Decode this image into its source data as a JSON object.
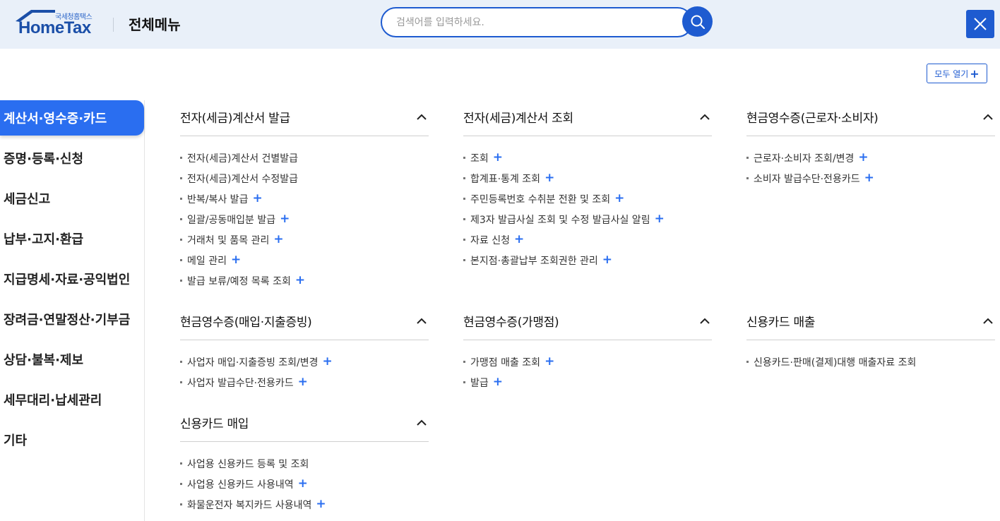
{
  "header": {
    "logo_sub": "국세청홈택스",
    "logo_main": "HomeTax",
    "title": "전체메뉴",
    "search_placeholder": "검색어를 입력하세요.",
    "search_icon": "search-icon",
    "close_icon": "close-icon"
  },
  "open_all": {
    "label": "모두 열기",
    "plus": "+"
  },
  "sidebar": {
    "items": [
      {
        "label": "계산서·영수증·카드",
        "active": true
      },
      {
        "label": "증명·등록·신청"
      },
      {
        "label": "세금신고"
      },
      {
        "label": "납부·고지·환급"
      },
      {
        "label": "지급명세·자료·공익법인"
      },
      {
        "label": "장려금·연말정산·기부금"
      },
      {
        "label": "상담·불복·제보"
      },
      {
        "label": "세무대리·납세관리"
      },
      {
        "label": "기타"
      }
    ]
  },
  "sections": [
    {
      "title": "전자(세금)계산서 발급",
      "items": [
        {
          "label": "전자(세금)계산서 건별발급",
          "plus": false
        },
        {
          "label": "전자(세금)계산서 수정발급",
          "plus": false
        },
        {
          "label": "반복/복사 발급",
          "plus": true
        },
        {
          "label": "일괄/공동매입분 발급",
          "plus": true
        },
        {
          "label": "거래처 및 품목 관리",
          "plus": true
        },
        {
          "label": "메일 관리",
          "plus": true
        },
        {
          "label": "발급 보류/예정 목록 조회",
          "plus": true
        }
      ]
    },
    {
      "title": "전자(세금)계산서 조회",
      "items": [
        {
          "label": "조회",
          "plus": true
        },
        {
          "label": "합계표·통계 조회",
          "plus": true
        },
        {
          "label": "주민등록번호 수취분 전환 및 조회",
          "plus": true
        },
        {
          "label": "제3자 발급사실 조회 및 수정 발급사실 알림",
          "plus": true
        },
        {
          "label": "자료 신청",
          "plus": true
        },
        {
          "label": "본지점·총괄납부 조회권한 관리",
          "plus": true
        }
      ]
    },
    {
      "title": "현금영수증(근로자·소비자)",
      "items": [
        {
          "label": "근로자·소비자 조회/변경",
          "plus": true
        },
        {
          "label": "소비자 발급수단·전용카드",
          "plus": true
        }
      ]
    },
    {
      "title": "현금영수증(매입·지출증빙)",
      "items": [
        {
          "label": "사업자 매입·지출증빙 조회/변경",
          "plus": true
        },
        {
          "label": "사업자 발급수단·전용카드",
          "plus": true
        }
      ]
    },
    {
      "title": "현금영수증(가맹점)",
      "items": [
        {
          "label": "가맹점 매출 조회",
          "plus": true
        },
        {
          "label": "발급",
          "plus": true
        }
      ]
    },
    {
      "title": "신용카드 매출",
      "items": [
        {
          "label": "신용카드·판매(결제)대행 매출자료 조회",
          "plus": false
        }
      ]
    },
    {
      "title": "신용카드 매입",
      "items": [
        {
          "label": "사업용 신용카드 등록 및 조회",
          "plus": false
        },
        {
          "label": "사업용 신용카드 사용내역",
          "plus": true
        },
        {
          "label": "화물운전자 복지카드 사용내역",
          "plus": true
        }
      ]
    }
  ],
  "colors": {
    "accent": "#2a6ef0",
    "brand": "#1e5bd0",
    "header_bg": "#e9f0f9"
  }
}
